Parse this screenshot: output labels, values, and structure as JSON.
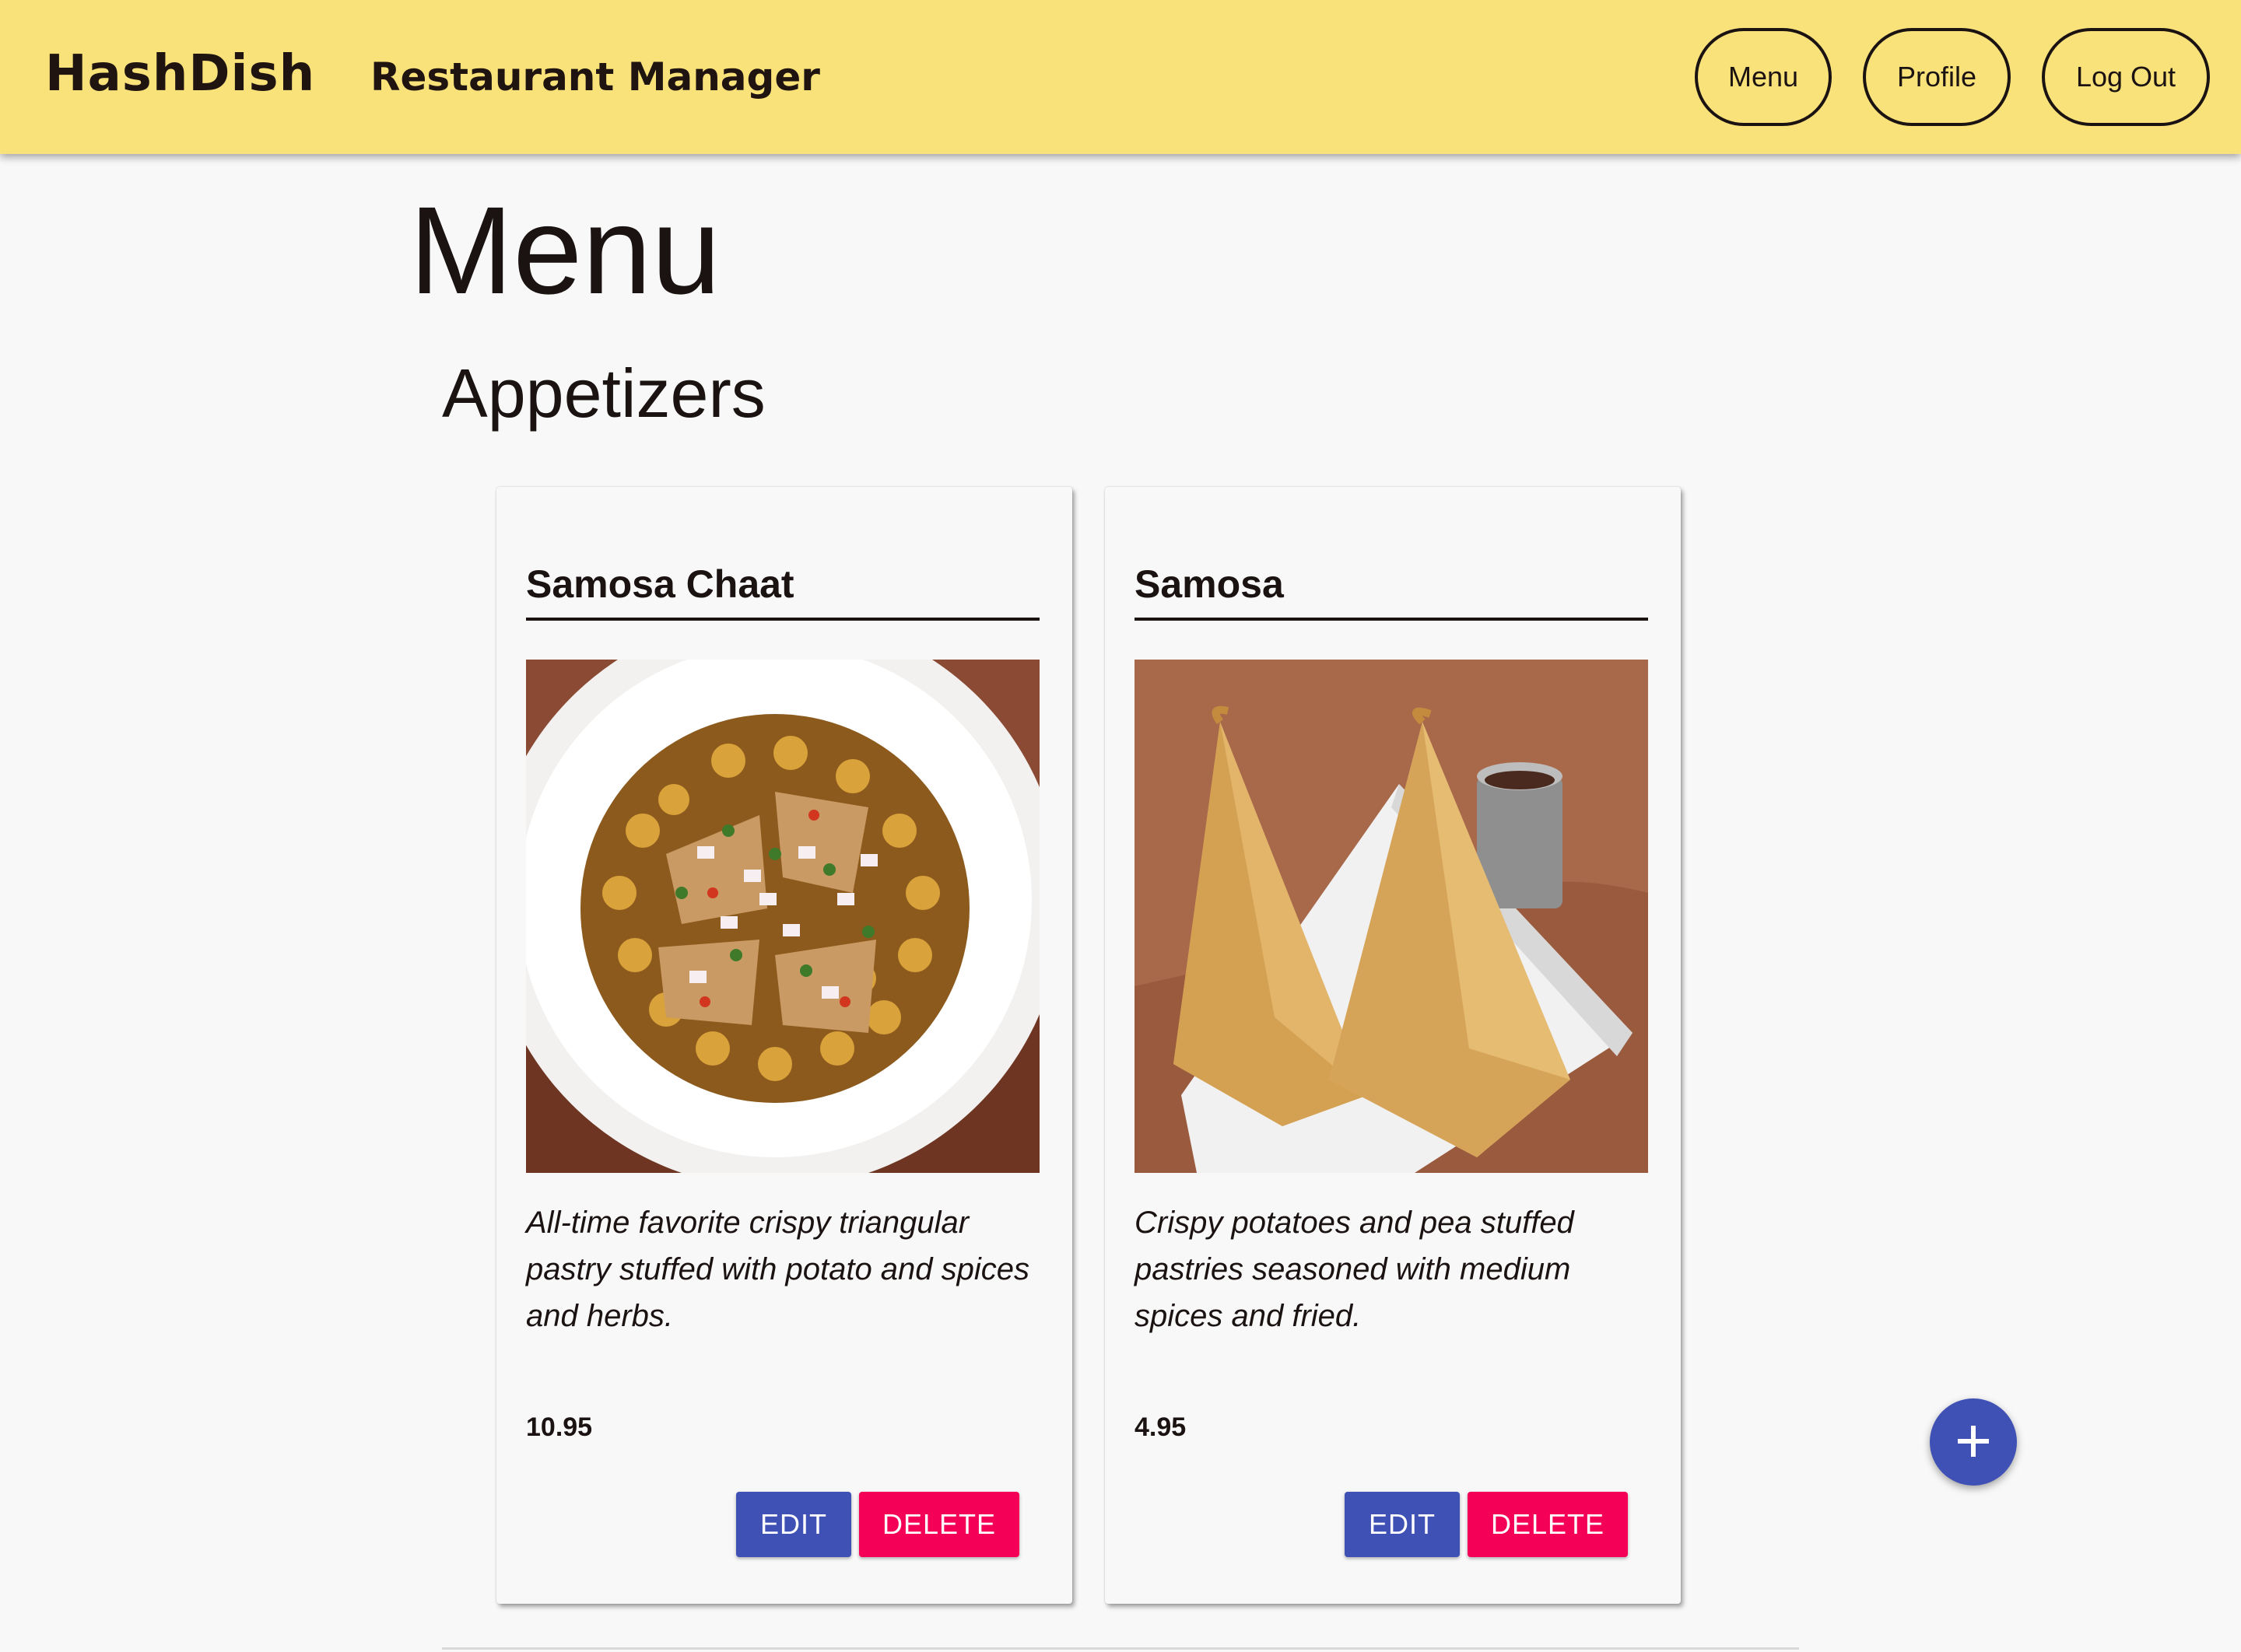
{
  "header": {
    "brand": "HashDish",
    "app_title": "Restaurant Manager",
    "nav": {
      "menu_label": "Menu",
      "profile_label": "Profile",
      "logout_label": "Log Out"
    },
    "background_color": "#f9e27a"
  },
  "page": {
    "title": "Menu",
    "section_title": "Appetizers"
  },
  "items": [
    {
      "name": "Samosa Chaat",
      "description": "All-time favorite crispy triangular pastry stuffed with potato and spices and herbs.",
      "price": "10.95",
      "edit_label": "EDIT",
      "delete_label": "DELETE",
      "image_icon": "samosa-chaat-photo"
    },
    {
      "name": "Samosa",
      "description": "Crispy potatoes and pea stuffed pastries seasoned with medium spices and fried.",
      "price": "4.95",
      "edit_label": "EDIT",
      "delete_label": "DELETE",
      "image_icon": "samosa-photo"
    }
  ],
  "fab": {
    "icon": "plus-icon",
    "color": "#3f51b5"
  },
  "colors": {
    "edit": "#3f51b5",
    "delete": "#f50057"
  }
}
